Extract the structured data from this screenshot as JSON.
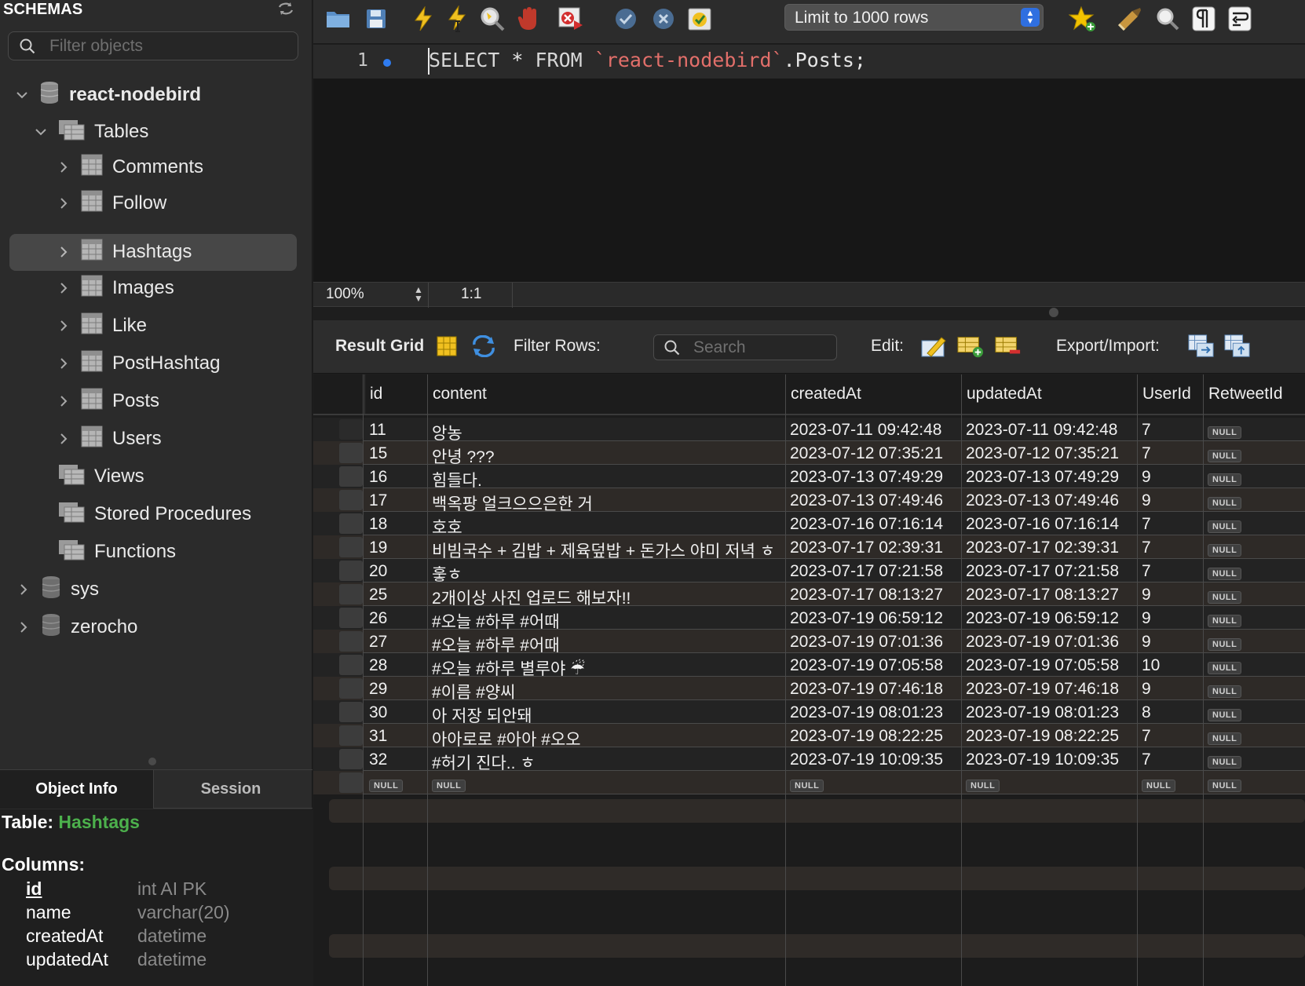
{
  "sidebar": {
    "title": "SCHEMAS",
    "filter_placeholder": "Filter objects",
    "tree": {
      "db1": "react-nodebird",
      "tables": "Tables",
      "table_items": [
        "Comments",
        "Follow",
        "Hashtags",
        "Images",
        "Like",
        "PostHashtag",
        "Posts",
        "Users"
      ],
      "views": "Views",
      "procedures": "Stored Procedures",
      "functions": "Functions",
      "db2": "sys",
      "db3": "zerocho"
    },
    "selected": "Hashtags"
  },
  "info": {
    "tabs": [
      "Object Info",
      "Session"
    ],
    "table_label": "Table:",
    "table_name": "Hashtags",
    "columns_label": "Columns:",
    "columns": [
      {
        "name": "id",
        "type": "int AI PK"
      },
      {
        "name": "name",
        "type": "varchar(20)"
      },
      {
        "name": "createdAt",
        "type": "datetime"
      },
      {
        "name": "updatedAt",
        "type": "datetime"
      }
    ]
  },
  "toolbar": {
    "limit": "Limit to 1000 rows",
    "icons": [
      "open-folder-icon",
      "save-icon",
      "execute-icon",
      "execute-current-icon",
      "explain-icon",
      "stop-icon",
      "toggle-error-icon",
      "commit-icon",
      "rollback-icon",
      "autocommit-icon",
      "limit-select",
      "bookmark-icon",
      "beautify-icon",
      "find-icon",
      "invisible-chars-icon",
      "wrap-icon"
    ]
  },
  "editor": {
    "line_number": "1",
    "sql": {
      "kw1": "SELECT",
      "op": " * ",
      "kw2": "FROM",
      "space": " ",
      "schema": "`react-nodebird`",
      "rest": ".Posts;"
    },
    "zoom": "100%",
    "position": "1:1"
  },
  "result": {
    "label": "Result Grid",
    "filter_label": "Filter Rows:",
    "search_placeholder": "Search",
    "edit_label": "Edit:",
    "export_label": "Export/Import:",
    "columns": [
      "id",
      "content",
      "createdAt",
      "updatedAt",
      "UserId",
      "RetweetId"
    ],
    "null_text": "NULL",
    "rows": [
      {
        "id": "11",
        "content": "앙농",
        "createdAt": "2023-07-11 09:42:48",
        "updatedAt": "2023-07-11 09:42:48",
        "UserId": "7"
      },
      {
        "id": "15",
        "content": "안녕 ???",
        "createdAt": "2023-07-12 07:35:21",
        "updatedAt": "2023-07-12 07:35:21",
        "UserId": "7"
      },
      {
        "id": "16",
        "content": "힘들다.",
        "createdAt": "2023-07-13 07:49:29",
        "updatedAt": "2023-07-13 07:49:29",
        "UserId": "9"
      },
      {
        "id": "17",
        "content": "백옥팡 얼크으으은한 거",
        "createdAt": "2023-07-13 07:49:46",
        "updatedAt": "2023-07-13 07:49:46",
        "UserId": "9"
      },
      {
        "id": "18",
        "content": "호호",
        "createdAt": "2023-07-16 07:16:14",
        "updatedAt": "2023-07-16 07:16:14",
        "UserId": "7"
      },
      {
        "id": "19",
        "content": "비빔국수 + 김밥 + 제육덮밥 + 돈가스 야미 저녁 ㅎ",
        "createdAt": "2023-07-17 02:39:31",
        "updatedAt": "2023-07-17 02:39:31",
        "UserId": "7"
      },
      {
        "id": "20",
        "content": "훟ㅎ",
        "createdAt": "2023-07-17 07:21:58",
        "updatedAt": "2023-07-17 07:21:58",
        "UserId": "7"
      },
      {
        "id": "25",
        "content": "2개이상 사진 업로드 해보자!!",
        "createdAt": "2023-07-17 08:13:27",
        "updatedAt": "2023-07-17 08:13:27",
        "UserId": "9"
      },
      {
        "id": "26",
        "content": "#오늘 #하루 #어때",
        "createdAt": "2023-07-19 06:59:12",
        "updatedAt": "2023-07-19 06:59:12",
        "UserId": "9"
      },
      {
        "id": "27",
        "content": "#오늘 #하루 #어때",
        "createdAt": "2023-07-19 07:01:36",
        "updatedAt": "2023-07-19 07:01:36",
        "UserId": "9"
      },
      {
        "id": "28",
        "content": "#오늘 #하루 별루야 ☔",
        "createdAt": "2023-07-19 07:05:58",
        "updatedAt": "2023-07-19 07:05:58",
        "UserId": "10"
      },
      {
        "id": "29",
        "content": "#이름 #양씨",
        "createdAt": "2023-07-19 07:46:18",
        "updatedAt": "2023-07-19 07:46:18",
        "UserId": "9"
      },
      {
        "id": "30",
        "content": "아 저장 되안돼",
        "createdAt": "2023-07-19 08:01:23",
        "updatedAt": "2023-07-19 08:01:23",
        "UserId": "8"
      },
      {
        "id": "31",
        "content": "아아로로 #아아 #오오",
        "createdAt": "2023-07-19 08:22:25",
        "updatedAt": "2023-07-19 08:22:25",
        "UserId": "7"
      },
      {
        "id": "32",
        "content": "#허기 진다.. ㅎ",
        "createdAt": "2023-07-19 10:09:35",
        "updatedAt": "2023-07-19 10:09:35",
        "UserId": "7"
      }
    ]
  },
  "colors": {
    "accent": "#2f6fe0",
    "table_name": "#4cb04c",
    "string": "#e26f6a"
  }
}
